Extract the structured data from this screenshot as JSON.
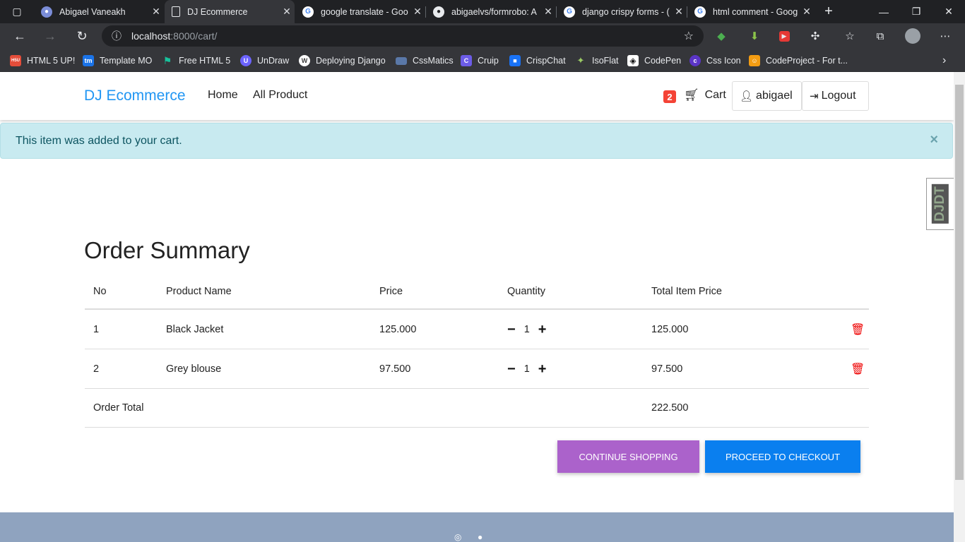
{
  "tabs": [
    {
      "title": "Abigael Vaneakh",
      "icon": "profile-avatar-icon"
    },
    {
      "title": "DJ Ecommerce",
      "icon": "page-icon"
    },
    {
      "title": "google translate - Goo",
      "icon": "google-icon"
    },
    {
      "title": "abigaelvs/formrobo: A",
      "icon": "github-icon"
    },
    {
      "title": "django crispy forms - (",
      "icon": "google-icon"
    },
    {
      "title": "html comment - Goog",
      "icon": "google-icon"
    }
  ],
  "address": {
    "host": "localhost",
    "rest": ":8000/cart/"
  },
  "bookmarks": [
    {
      "label": "HTML 5 UP!",
      "color": "#e44d3a",
      "glyph": "H5U"
    },
    {
      "label": "Template MO",
      "color": "#1a73e8",
      "glyph": "tm"
    },
    {
      "label": "Free HTML 5",
      "color": "#18c29c",
      "glyph": "⚑"
    },
    {
      "label": "UnDraw",
      "color": "#6c63ff",
      "glyph": "U"
    },
    {
      "label": "Deploying Django",
      "color": "#3c3c3c",
      "glyph": "W"
    },
    {
      "label": "CssMatics",
      "color": "#5a78a8",
      "glyph": ""
    },
    {
      "label": "Cruip",
      "color": "#6c5ce7",
      "glyph": "C"
    },
    {
      "label": "CrispChat",
      "color": "#1972f5",
      "glyph": "■"
    },
    {
      "label": "IsoFlat",
      "color": "#2c3e50",
      "glyph": "✦"
    },
    {
      "label": "CodePen",
      "color": "#111",
      "glyph": "◈"
    },
    {
      "label": "Css Icon",
      "color": "#5b35c7",
      "glyph": "c"
    },
    {
      "label": "CodeProject - For t...",
      "color": "#f39c12",
      "glyph": "☺"
    }
  ],
  "nav": {
    "brand": "DJ Ecommerce",
    "home": "Home",
    "all_product": "All Product",
    "cart_count": "2",
    "cart": "Cart",
    "user": "abigael",
    "logout": "Logout"
  },
  "alert": {
    "message": "This item was added to your cart.",
    "close": "×"
  },
  "djdt": "DJDT",
  "order": {
    "title": "Order Summary",
    "headers": {
      "no": "No",
      "name": "Product Name",
      "price": "Price",
      "qty": "Quantity",
      "total": "Total Item Price"
    },
    "items": [
      {
        "no": "1",
        "name": "Black Jacket",
        "price": "125.000",
        "qty": "1",
        "total": "125.000"
      },
      {
        "no": "2",
        "name": "Grey blouse",
        "price": "97.500",
        "qty": "1",
        "total": "97.500"
      }
    ],
    "total_label": "Order Total",
    "total_value": "222.500",
    "continue": "Continue shopping",
    "checkout": "Proceed to checkout"
  },
  "colors": {
    "brand": "#2196f3",
    "continue_btn": "#ab62cb",
    "checkout_btn": "#0a7fef",
    "badge": "#f44336",
    "trash": "#e00000"
  }
}
